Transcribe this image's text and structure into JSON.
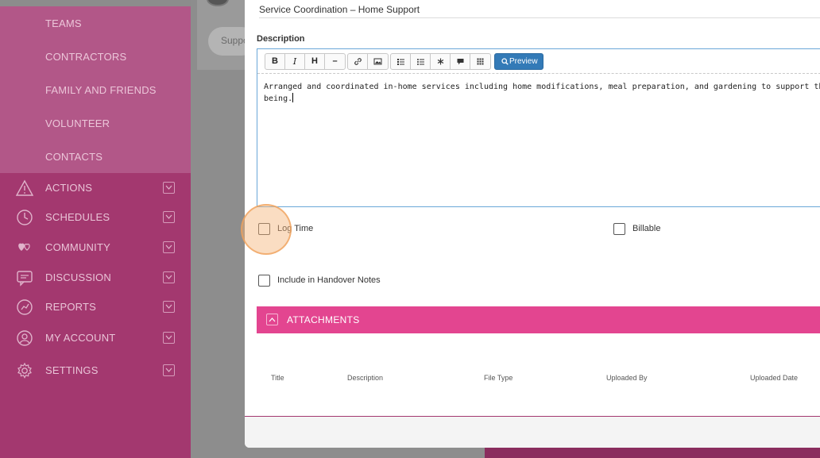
{
  "sidebar": {
    "subnav": [
      "TEAMS",
      "CONTRACTORS",
      "FAMILY AND FRIENDS",
      "VOLUNTEER",
      "CONTACTS"
    ],
    "items": [
      {
        "label": "ACTIONS",
        "icon": "warning-icon"
      },
      {
        "label": "SCHEDULES",
        "icon": "clock-icon"
      },
      {
        "label": "COMMUNITY",
        "icon": "hearts-icon"
      },
      {
        "label": "DISCUSSION",
        "icon": "chat-icon"
      },
      {
        "label": "REPORTS",
        "icon": "chart-icon"
      },
      {
        "label": "MY ACCOUNT",
        "icon": "user-icon"
      },
      {
        "label": "SETTINGS",
        "icon": "gear-icon"
      }
    ]
  },
  "background": {
    "pill_text": "Suppo"
  },
  "modal": {
    "title_value": "Service Coordination – Home Support",
    "description_label": "Description",
    "editor": {
      "toolbar": {
        "bold": "B",
        "italic": "I",
        "heading": "H",
        "hr": "–",
        "preview": "Preview"
      },
      "text_line1": "Arranged and coordinated in-home services including home modifications, meal preparation, and gardening to support the cli",
      "text_line2": "being."
    },
    "checkboxes": {
      "log_time": "Log Time",
      "billable": "Billable",
      "handover": "Include in Handover Notes"
    },
    "attachments": {
      "title": "ATTACHMENTS",
      "columns": [
        "Title",
        "Description",
        "File Type",
        "Uploaded By",
        "Uploaded Date"
      ]
    }
  },
  "colors": {
    "sidebar": "#a3386f",
    "subnav": "#b25788",
    "accent": "#e34590",
    "preview": "#337ab7"
  }
}
